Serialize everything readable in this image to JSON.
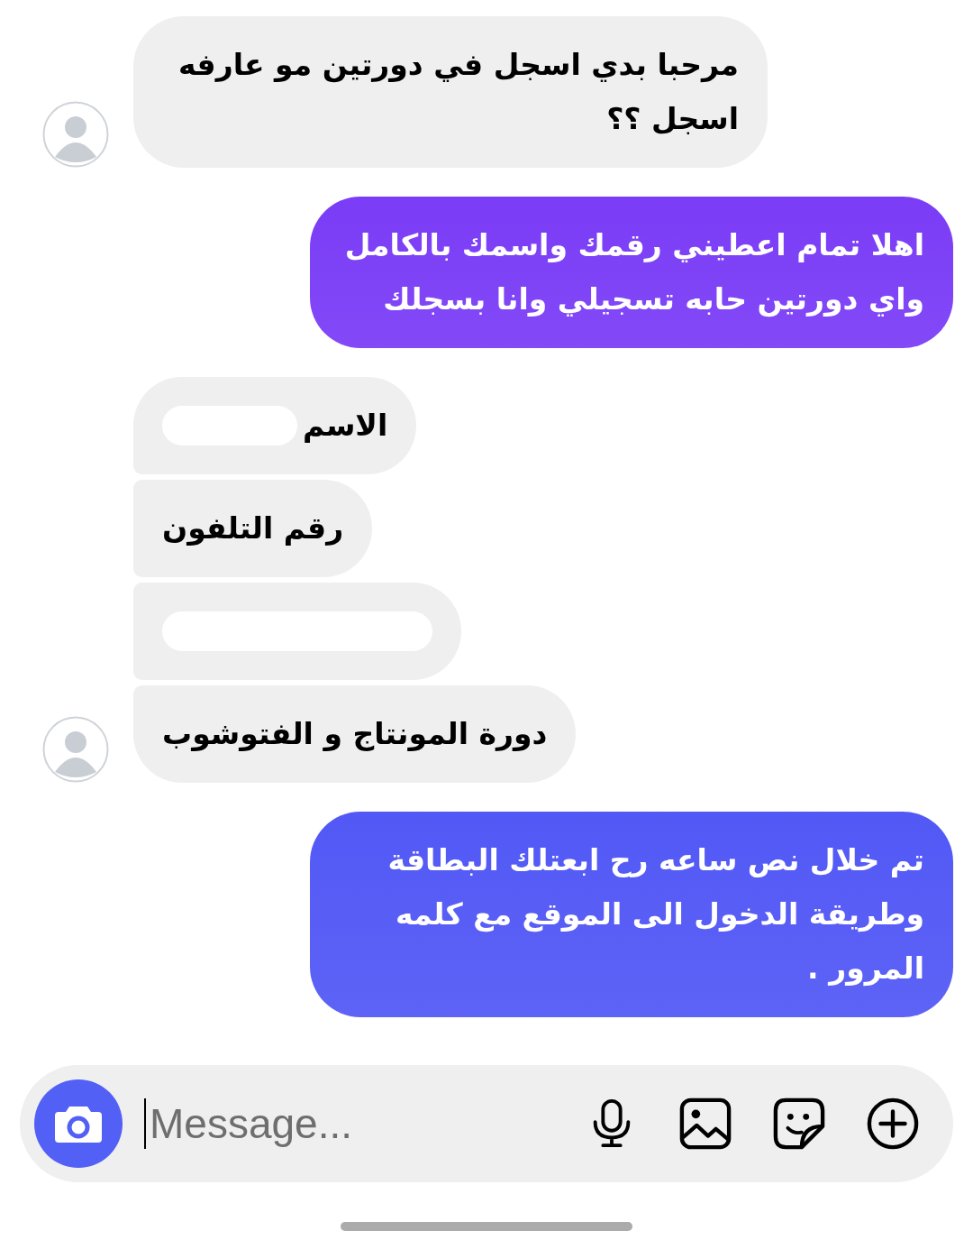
{
  "messages": [
    {
      "kind": "incoming",
      "text": "مرحبا بدي اسجل في دورتين مو عارفه اسجل ؟؟",
      "avatar": true,
      "color": "#efefef"
    },
    {
      "kind": "outgoing",
      "text": "اهلا تمام اعطيني رقمك واسمك بالكامل واي دورتين حابه تسجيلي وانا بسجلك",
      "color": "#7a3cf6"
    },
    {
      "kind": "incoming",
      "text": "الاسم",
      "redacted": true,
      "avatar": false,
      "color": "#efefef"
    },
    {
      "kind": "incoming",
      "text": "رقم التلفون",
      "avatar": false,
      "color": "#efefef"
    },
    {
      "kind": "incoming",
      "redacted": true,
      "avatar": false,
      "color": "#efefef"
    },
    {
      "kind": "incoming",
      "text": "دورة المونتاج و الفتوشوب",
      "avatar": true,
      "color": "#efefef"
    },
    {
      "kind": "outgoing",
      "text": "تم خلال نص ساعه رح ابعتلك البطاقة وطريقة الدخول الى الموقع مع كلمه المرور .",
      "color": "#5258f5"
    }
  ],
  "composer": {
    "placeholder": "Message..."
  }
}
